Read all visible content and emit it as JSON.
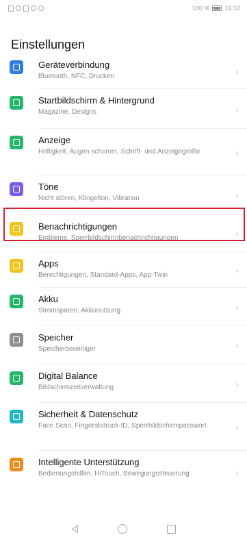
{
  "status": {
    "left_icons": [
      "sim-icon",
      "wifi-icon",
      "data-icon",
      "signal-icon",
      "alarm-icon"
    ],
    "battery": "100 %",
    "time": "16:12"
  },
  "title": "Einstellungen",
  "items": [
    {
      "label": "Geräteverbindung",
      "sub": "Bluetooth, NFC, Drucken",
      "icon": "device-connection-icon",
      "color": "#2f7de1"
    },
    {
      "label": "Startbildschirm & Hintergrund",
      "sub": "Magazine, Designs",
      "icon": "wallpaper-icon",
      "color": "#22b86a"
    },
    {
      "label": "Anzeige",
      "sub": "Helligkeit, Augen schonen, Schrift- und Anzeigegröße",
      "icon": "display-icon",
      "color": "#22b86a"
    },
    {
      "label": "Töne",
      "sub": "Nicht stören, Klingelton, Vibration",
      "icon": "sound-icon",
      "color": "#7b5de8"
    },
    {
      "label": "Benachrichtigungen",
      "sub": "Embleme, Sperrbildschirmbenachrichtigungen",
      "icon": "notification-icon",
      "color": "#f2c31b"
    },
    {
      "label": "Apps",
      "sub": "Berechtigungen, Standard-Apps, App-Twin",
      "icon": "apps-icon",
      "color": "#f2c31b"
    },
    {
      "label": "Akku",
      "sub": "Stromsparen, Akkunutzung",
      "icon": "battery-icon",
      "color": "#22b86a"
    },
    {
      "label": "Speicher",
      "sub": "Speicherbereiniger",
      "icon": "storage-icon",
      "color": "#8f8f8f"
    },
    {
      "label": "Digital Balance",
      "sub": "Bildschirmzeitverwaltung",
      "icon": "hourglass-icon",
      "color": "#22b86a"
    },
    {
      "label": "Sicherheit & Datenschutz",
      "sub": "Face Scan, Fingerabdruck-ID, Sperrbildschirmpasswort",
      "icon": "security-icon",
      "color": "#21b7c7"
    },
    {
      "label": "Intelligente Unterstützung",
      "sub": "Bedienungshilfen, HiTouch, Bewegungssteuerung",
      "icon": "assist-icon",
      "color": "#f08c1e"
    }
  ],
  "nav": {
    "back": "back-icon",
    "home": "home-icon",
    "recent": "recent-apps-icon"
  }
}
